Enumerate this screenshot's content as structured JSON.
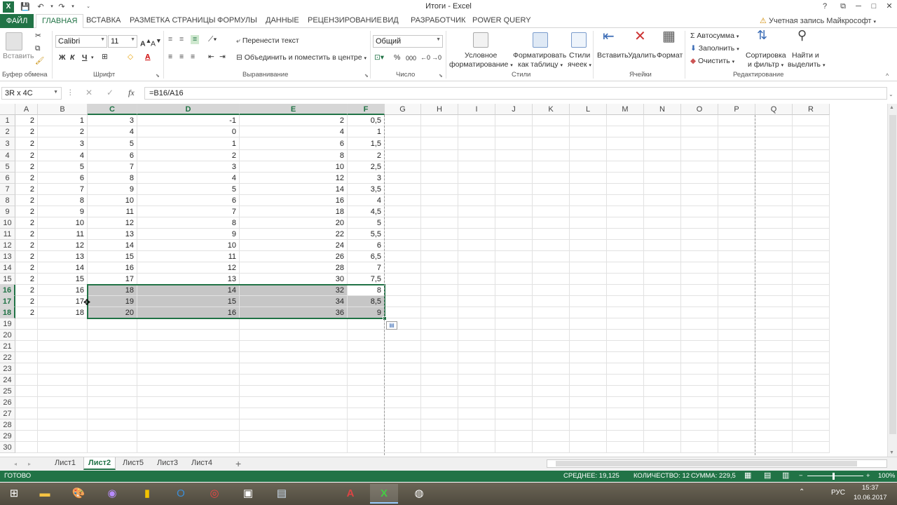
{
  "window": {
    "title": "Итоги - Excel",
    "account": "Учетная запись Майкрософт",
    "help": "?",
    "restore_ribbon": "⧉",
    "minimize": "─",
    "maximize": "□",
    "close": "✕"
  },
  "quick_access": {
    "save_icon": "save-icon",
    "undo_icon": "undo-icon",
    "redo_icon": "redo-icon"
  },
  "tabs": [
    "ФАЙЛ",
    "ГЛАВНАЯ",
    "ВСТАВКА",
    "РАЗМЕТКА СТРАНИЦЫ",
    "ФОРМУЛЫ",
    "ДАННЫЕ",
    "РЕЦЕНЗИРОВАНИЕ",
    "ВИД",
    "РАЗРАБОТЧИК",
    "POWER QUERY"
  ],
  "ribbon": {
    "clipboard": {
      "paste": "Вставить",
      "label": "Буфер обмена"
    },
    "font": {
      "name": "Calibri",
      "size": "11",
      "bold": "Ж",
      "italic": "К",
      "underline": "Ч",
      "label": "Шрифт",
      "font_color": "A"
    },
    "alignment": {
      "wrap": "Перенести текст",
      "merge": "Объединить и поместить в центре",
      "label": "Выравнивание"
    },
    "number": {
      "format": "Общий",
      "percent": "%",
      "thousands": "000",
      "label": "Число"
    },
    "styles": {
      "conditional": "Условное",
      "conditional2": "форматирование",
      "as_table": "Форматировать",
      "as_table2": "как таблицу",
      "cell_styles": "Стили",
      "cell_styles2": "ячеек",
      "label": "Стили"
    },
    "cells": {
      "insert": "Вставить",
      "delete": "Удалить",
      "format": "Формат",
      "label": "Ячейки"
    },
    "editing": {
      "autosum": "Автосумма",
      "fill": "Заполнить",
      "clear": "Очистить",
      "sort": "Сортировка",
      "sort2": "и фильтр",
      "find": "Найти и",
      "find2": "выделить",
      "label": "Редактирование"
    }
  },
  "formula_bar": {
    "name_box": "3R x 4C",
    "fx": "fx",
    "formula": "=B16/A16",
    "cancel": "✕",
    "enter": "✓"
  },
  "grid": {
    "columns": [
      "A",
      "B",
      "C",
      "D",
      "E",
      "F",
      "G",
      "H",
      "I",
      "J",
      "K",
      "L",
      "M",
      "N",
      "O",
      "P",
      "Q",
      "R"
    ],
    "rows": [
      [
        "2",
        "1",
        "3",
        "-1",
        "2",
        "0,5"
      ],
      [
        "2",
        "2",
        "4",
        "0",
        "4",
        "1"
      ],
      [
        "2",
        "3",
        "5",
        "1",
        "6",
        "1,5"
      ],
      [
        "2",
        "4",
        "6",
        "2",
        "8",
        "2"
      ],
      [
        "2",
        "5",
        "7",
        "3",
        "10",
        "2,5"
      ],
      [
        "2",
        "6",
        "8",
        "4",
        "12",
        "3"
      ],
      [
        "2",
        "7",
        "9",
        "5",
        "14",
        "3,5"
      ],
      [
        "2",
        "8",
        "10",
        "6",
        "16",
        "4"
      ],
      [
        "2",
        "9",
        "11",
        "7",
        "18",
        "4,5"
      ],
      [
        "2",
        "10",
        "12",
        "8",
        "20",
        "5"
      ],
      [
        "2",
        "11",
        "13",
        "9",
        "22",
        "5,5"
      ],
      [
        "2",
        "12",
        "14",
        "10",
        "24",
        "6"
      ],
      [
        "2",
        "13",
        "15",
        "11",
        "26",
        "6,5"
      ],
      [
        "2",
        "14",
        "16",
        "12",
        "28",
        "7"
      ],
      [
        "2",
        "15",
        "17",
        "13",
        "30",
        "7,5"
      ],
      [
        "2",
        "16",
        "18",
        "14",
        "32",
        "8"
      ],
      [
        "2",
        "17",
        "19",
        "15",
        "34",
        "8,5"
      ],
      [
        "2",
        "18",
        "20",
        "16",
        "36",
        "9"
      ]
    ],
    "row_numbers": [
      "1",
      "2",
      "3",
      "4",
      "5",
      "6",
      "7",
      "8",
      "9",
      "10",
      "11",
      "12",
      "13",
      "14",
      "15",
      "16",
      "17",
      "18",
      "19",
      "20",
      "21",
      "22",
      "23",
      "24",
      "25",
      "26",
      "27",
      "28",
      "29",
      "30"
    ]
  },
  "sheets": {
    "tabs": [
      "Лист1",
      "Лист2",
      "Лист5",
      "Лист3",
      "Лист4"
    ],
    "active": "Лист2",
    "add": "+"
  },
  "status": {
    "ready": "ГОТОВО",
    "average": "СРЕДНЕЕ: 19,125",
    "count": "КОЛИЧЕСТВО: 12",
    "sum": "СУММА: 229,5",
    "zoom": "100%",
    "zoom_minus": "−",
    "zoom_plus": "+"
  },
  "taskbar": {
    "lang": "РУС",
    "time": "15:37",
    "date": "10.06.2017"
  },
  "colors": {
    "accent": "#217346",
    "selection": "#c6c6c6"
  }
}
